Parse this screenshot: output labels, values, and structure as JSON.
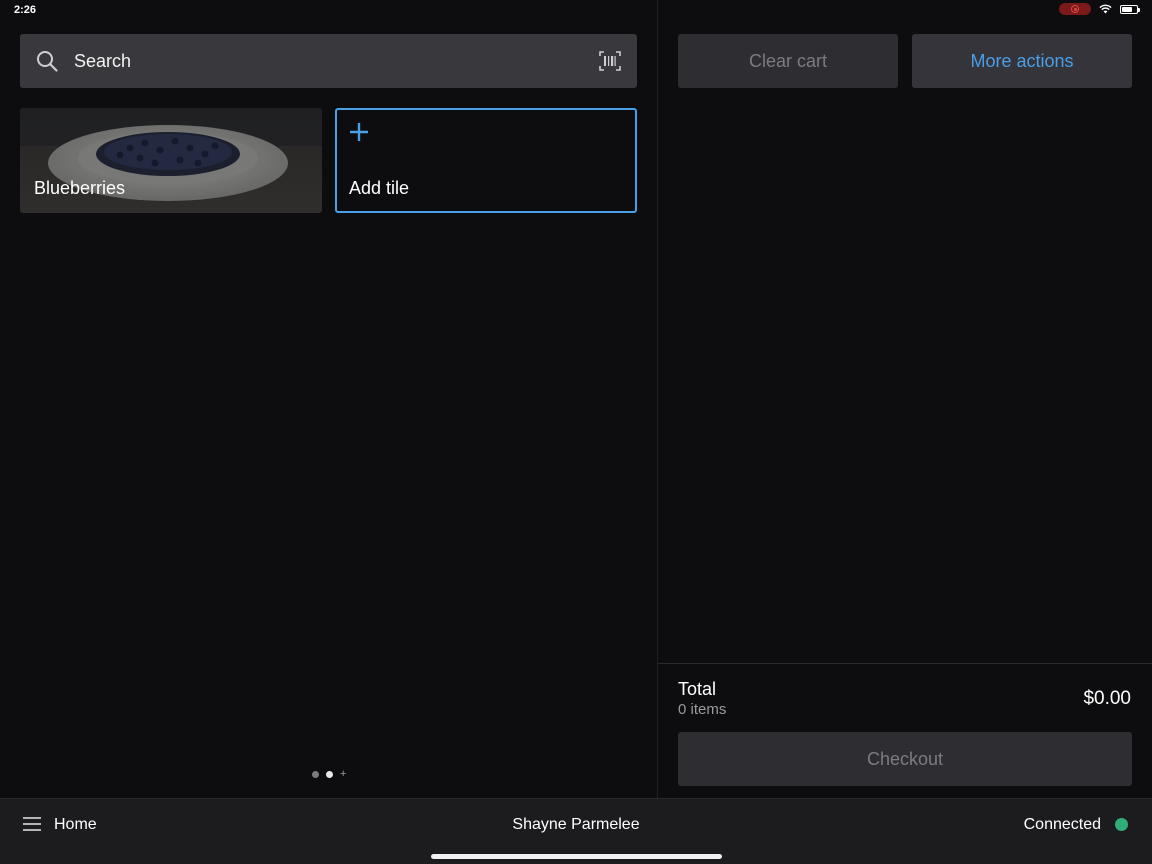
{
  "status_bar": {
    "time": "2:26",
    "icons": [
      "screen-record-icon",
      "wifi-icon",
      "battery-icon"
    ]
  },
  "search": {
    "placeholder": "Search",
    "icon": "search-icon",
    "scan_icon": "barcode-scan-icon"
  },
  "tiles": [
    {
      "label": "Blueberries",
      "type": "item"
    },
    {
      "label": "Add tile",
      "type": "add",
      "icon": "plus-icon"
    }
  ],
  "pagination": {
    "pages": 2,
    "current": 2,
    "add_symbol": "+"
  },
  "cart": {
    "clear_label": "Clear cart",
    "more_label": "More actions",
    "total_label": "Total",
    "items_count": "0 items",
    "total_amount": "$0.00",
    "checkout_label": "Checkout"
  },
  "bottom_bar": {
    "menu_icon": "hamburger-menu-icon",
    "home_label": "Home",
    "user_name": "Shayne Parmelee",
    "connection_label": "Connected",
    "connection_color": "#2fae7a"
  },
  "colors": {
    "accent": "#4a9fe6",
    "background": "#0d0d10",
    "surface": "#39393d",
    "disabled_text": "#7c7c80"
  }
}
